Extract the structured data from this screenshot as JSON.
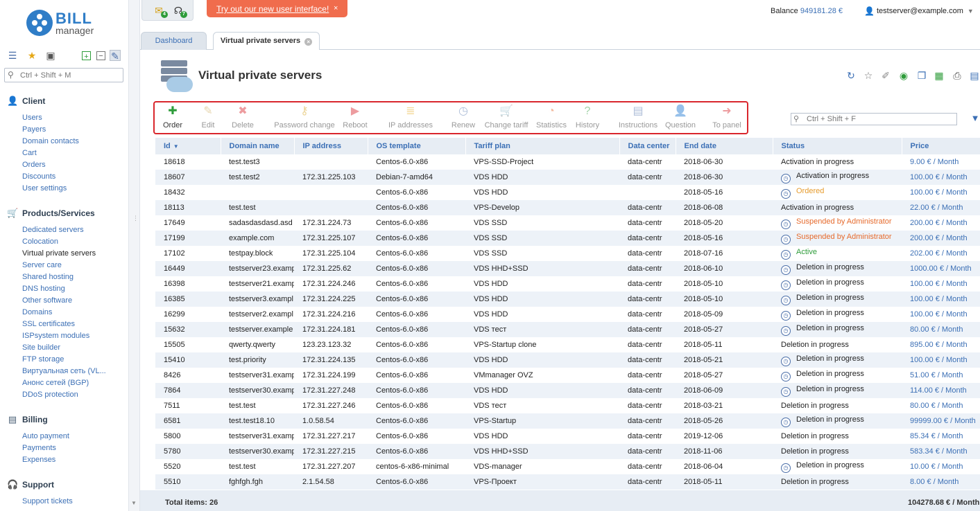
{
  "app": {
    "logo_word1": "BILL",
    "logo_word2": "manager"
  },
  "sidebar": {
    "search_placeholder": "Ctrl + Shift + M",
    "sections": [
      {
        "title": "Client",
        "icon": "client-icon",
        "items": [
          "Users",
          "Payers",
          "Domain contacts",
          "Cart",
          "Orders",
          "Discounts",
          "User settings"
        ]
      },
      {
        "title": "Products/Services",
        "icon": "cart-icon",
        "items": [
          "Dedicated servers",
          "Colocation",
          "Virtual private servers",
          "Server care",
          "Shared hosting",
          "DNS hosting",
          "Other software",
          "Domains",
          "SSL certificates",
          "ISPsystem modules",
          "Site builder",
          "FTP storage",
          "Виртуальная сеть (VL...",
          "Анонс сетей (BGP)",
          "DDoS protection"
        ]
      },
      {
        "title": "Billing",
        "icon": "billing-icon",
        "items": [
          "Auto payment",
          "Payments",
          "Expenses"
        ]
      },
      {
        "title": "Support",
        "icon": "headset-icon",
        "items": [
          "Support tickets"
        ]
      }
    ],
    "active_item": "Virtual private servers"
  },
  "topbar": {
    "notify_badge_1": "4",
    "notify_badge_2": "7",
    "promo_text": "Try out our new user interface!",
    "promo_close": "×",
    "balance_label": "Balance",
    "balance_value": "949181.28 €",
    "user": "testserver@example.com"
  },
  "tabs": [
    {
      "label": "Dashboard"
    },
    {
      "label": "Virtual private servers"
    }
  ],
  "page": {
    "title": "Virtual private servers"
  },
  "toolbar": {
    "buttons": [
      "Order",
      "Edit",
      "Delete",
      "Password change",
      "Reboot",
      "IP addresses",
      "Renew",
      "Change tariff",
      "Statistics",
      "History",
      "Instructions",
      "Question",
      "To panel"
    ],
    "search_placeholder": "Ctrl + Shift + F"
  },
  "table": {
    "columns": [
      "Id",
      "Domain name",
      "IP address",
      "OS template",
      "Tariff plan",
      "Data center",
      "End date",
      "Status",
      "Price"
    ],
    "rows": [
      [
        "18618",
        "test.test3",
        "",
        "Centos-6.0-x86",
        "VPS-SSD-Project",
        "data-centr",
        "2018-06-30",
        "Activation in progress",
        "9.00 € / Month"
      ],
      [
        "18607",
        "test.test2",
        "172.31.225.103",
        "Debian-7-amd64",
        "VDS HDD",
        "data-centr",
        "2018-06-30",
        "Activation in progress",
        "100.00 € / Month"
      ],
      [
        "18432",
        "",
        "",
        "Centos-6.0-x86",
        "VDS HDD",
        "",
        "2018-05-16",
        "Ordered",
        "100.00 € / Month"
      ],
      [
        "18113",
        "test.test",
        "",
        "Centos-6.0-x86",
        "VPS-Develop",
        "data-centr",
        "2018-06-08",
        "Activation in progress",
        "22.00 € / Month"
      ],
      [
        "17649",
        "sadasdasdasd.asd",
        "172.31.224.73",
        "Centos-6.0-x86",
        "VDS SSD",
        "data-centr",
        "2018-05-20",
        "Suspended by Administrator",
        "200.00 € / Month"
      ],
      [
        "17199",
        "example.com",
        "172.31.225.107",
        "Centos-6.0-x86",
        "VDS SSD",
        "data-centr",
        "2018-05-16",
        "Suspended by Administrator",
        "200.00 € / Month"
      ],
      [
        "17102",
        "testpay.block",
        "172.31.225.104",
        "Centos-6.0-x86",
        "VDS SSD",
        "data-centr",
        "2018-07-16",
        "Active",
        "202.00 € / Month"
      ],
      [
        "16449",
        "testserver23.examp",
        "172.31.225.62",
        "Centos-6.0-x86",
        "VDS HHD+SSD",
        "data-centr",
        "2018-06-10",
        "Deletion in progress",
        "1000.00 € / Month"
      ],
      [
        "16398",
        "testserver21.examp",
        "172.31.224.246",
        "Centos-6.0-x86",
        "VDS HDD",
        "data-centr",
        "2018-05-10",
        "Deletion in progress",
        "100.00 € / Month"
      ],
      [
        "16385",
        "testserver3.exampl",
        "172.31.224.225",
        "Centos-6.0-x86",
        "VDS HDD",
        "data-centr",
        "2018-05-10",
        "Deletion in progress",
        "100.00 € / Month"
      ],
      [
        "16299",
        "testserver2.exampl",
        "172.31.224.216",
        "Centos-6.0-x86",
        "VDS HDD",
        "data-centr",
        "2018-05-09",
        "Deletion in progress",
        "100.00 € / Month"
      ],
      [
        "15632",
        "testserver.example",
        "172.31.224.181",
        "Centos-6.0-x86",
        "VDS тест",
        "data-centr",
        "2018-05-27",
        "Deletion in progress",
        "80.00 € / Month"
      ],
      [
        "15505",
        "qwerty.qwerty",
        "123.23.123.32",
        "Centos-6.0-x86",
        "VPS-Startup clone",
        "data-centr",
        "2018-05-11",
        "Deletion in progress",
        "895.00 € / Month"
      ],
      [
        "15410",
        "test.priority",
        "172.31.224.135",
        "Centos-6.0-x86",
        "VDS HDD",
        "data-centr",
        "2018-05-21",
        "Deletion in progress",
        "100.00 € / Month"
      ],
      [
        "8426",
        "testserver31.examp",
        "172.31.224.199",
        "Centos-6.0-x86",
        "VMmanager OVZ",
        "data-centr",
        "2018-05-27",
        "Deletion in progress",
        "51.00 € / Month"
      ],
      [
        "7864",
        "testserver30.examp",
        "172.31.227.248",
        "Centos-6.0-x86",
        "VDS HDD",
        "data-centr",
        "2018-06-09",
        "Deletion in progress",
        "114.00 € / Month"
      ],
      [
        "7511",
        "test.test",
        "172.31.227.246",
        "Centos-6.0-x86",
        "VDS тест",
        "data-centr",
        "2018-03-21",
        "Deletion in progress",
        "80.00 € / Month"
      ],
      [
        "6581",
        "test.test18.10",
        "1.0.58.54",
        "Centos-6.0-x86",
        "VPS-Startup",
        "data-centr",
        "2018-05-26",
        "Deletion in progress",
        "99999.00 € / Month"
      ],
      [
        "5800",
        "testserver31.examp",
        "172.31.227.217",
        "Centos-6.0-x86",
        "VDS HDD",
        "data-centr",
        "2019-12-06",
        "Deletion in progress",
        "85.34 € / Month"
      ],
      [
        "5780",
        "testserver30.examp",
        "172.31.227.215",
        "Centos-6.0-x86",
        "VDS HHD+SSD",
        "data-centr",
        "2018-11-06",
        "Deletion in progress",
        "583.34 € / Month"
      ],
      [
        "5520",
        "test.test",
        "172.31.227.207",
        "centos-6-x86-minimal",
        "VDS-manager",
        "data-centr",
        "2018-06-04",
        "Deletion in progress",
        "10.00 € / Month"
      ],
      [
        "5510",
        "fghfgh.fgh",
        "2.1.54.58",
        "Centos-6.0-x86",
        "VPS-Проект",
        "data-centr",
        "2018-05-11",
        "Deletion in progress",
        "8.00 € / Month"
      ]
    ],
    "status_icon_rows": [
      1,
      2,
      4,
      5,
      6,
      7,
      8,
      9,
      10,
      11,
      13,
      14,
      15,
      17,
      20
    ]
  },
  "footer": {
    "total_label": "Total items: 26",
    "sum": "104278.68 € / Month"
  },
  "colors": {
    "accent": "#3b6fb5",
    "promo": "#f06c4d",
    "toolbar_highlight": "#d9262c",
    "warn": "#e66a2c",
    "ordered": "#e69b2c",
    "active": "#2e9c3a"
  }
}
